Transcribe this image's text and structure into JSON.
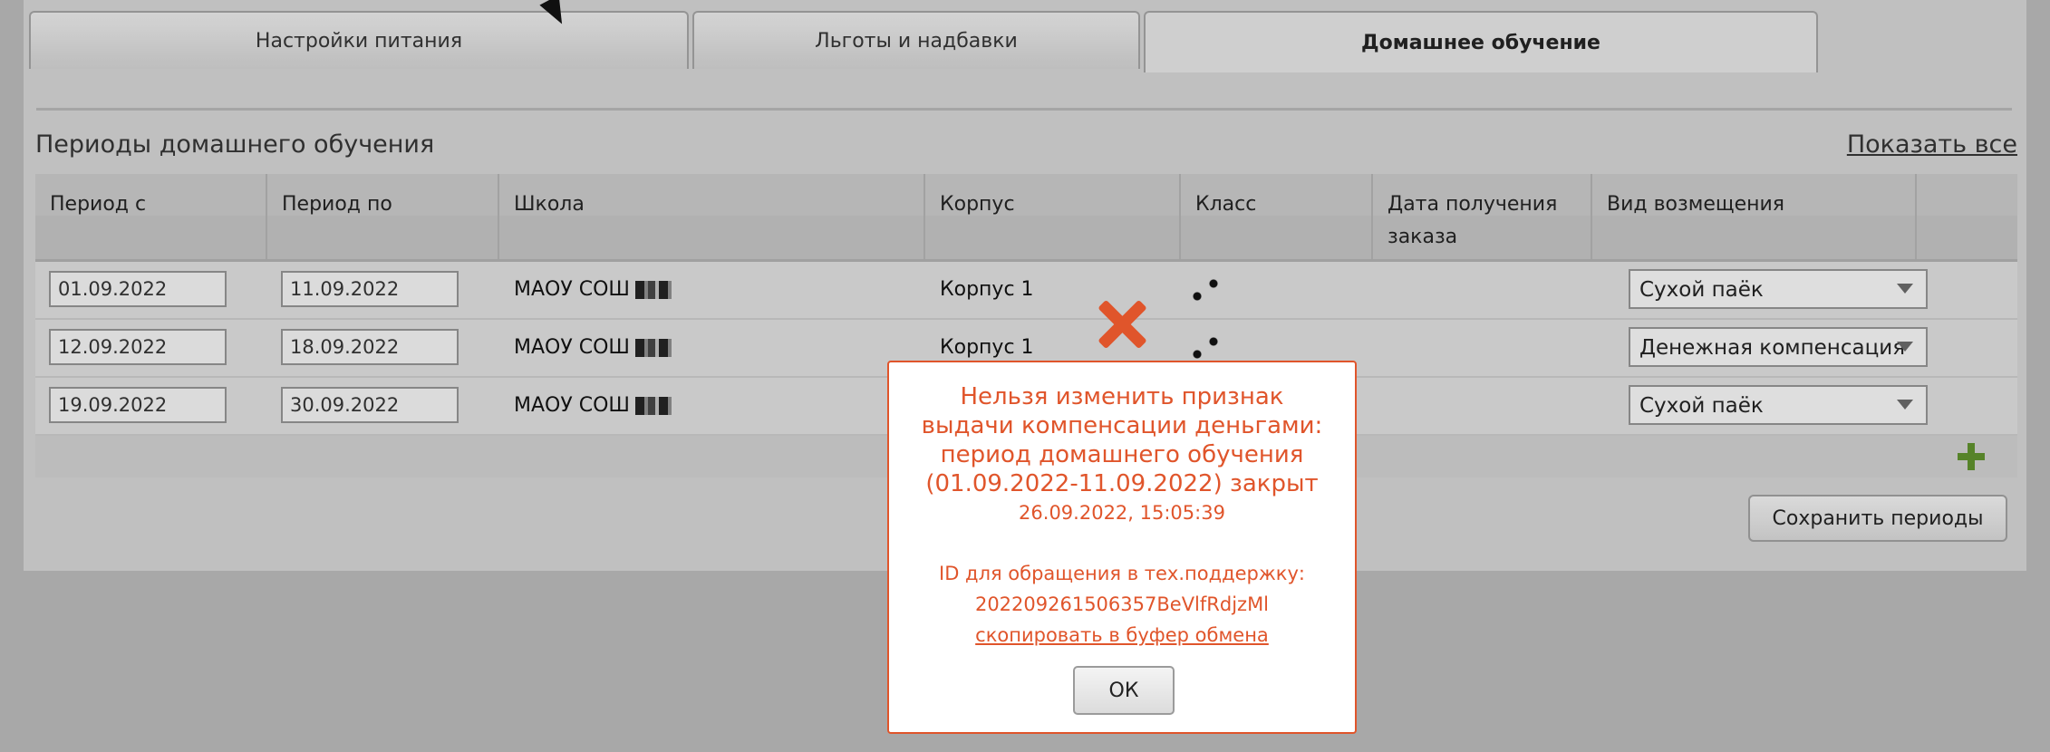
{
  "tabs": [
    {
      "label": "Настройки питания"
    },
    {
      "label": "Льготы и надбавки"
    },
    {
      "label": "Домашнее обучение"
    }
  ],
  "section": {
    "title": "Периоды домашнего обучения",
    "show_all": "Показать все"
  },
  "table": {
    "headers": [
      "Период с",
      "Период по",
      "Школа",
      "Корпус",
      "Класс",
      "Дата получения заказа",
      "Вид возмещения"
    ],
    "rows": [
      {
        "from": "01.09.2022",
        "to": "11.09.2022",
        "school": "МАОУ СОШ",
        "building": "Корпус 1",
        "compensation": "Сухой паёк"
      },
      {
        "from": "12.09.2022",
        "to": "18.09.2022",
        "school": "МАОУ СОШ",
        "building": "Корпус 1",
        "compensation": "Денежная компенсация"
      },
      {
        "from": "19.09.2022",
        "to": "30.09.2022",
        "school": "МАОУ СОШ",
        "building": "",
        "compensation": "Сухой паёк"
      }
    ]
  },
  "save_button": "Сохранить периоды",
  "dialog": {
    "message": "Нельзя изменить признак выдачи компенсации деньгами: период домашнего обучения (01.09.2022-11.09.2022) закрыт",
    "timestamp": "26.09.2022, 15:05:39",
    "support_label": "ID для обращения в тех.поддержку:",
    "support_id": "202209261506357BeVlfRdjzMl",
    "copy_link": "скопировать в буфер обмена",
    "ok": "ОК"
  },
  "colors": {
    "error": "#e0552b",
    "add": "#5c8c2c"
  }
}
